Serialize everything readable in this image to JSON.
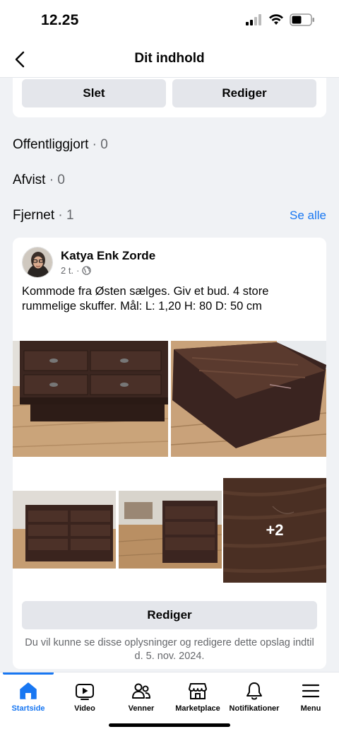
{
  "status_bar": {
    "time": "12.25"
  },
  "header": {
    "title": "Dit indhold"
  },
  "top_card": {
    "delete_label": "Slet",
    "edit_label": "Rediger"
  },
  "sections": {
    "published": {
      "label": "Offentliggjort",
      "count": "· 0"
    },
    "rejected": {
      "label": "Afvist",
      "count": "· 0"
    },
    "removed": {
      "label": "Fjernet",
      "count": "· 1",
      "see_all": "Se alle"
    }
  },
  "post": {
    "author": "Katya Enk Zorde",
    "time": "2 t.",
    "separator": "·",
    "text": "Kommode fra Østen sælges. Giv et bud. 4 store rummelige skuffer. Mål: L: 1,20 H: 80 D: 50 cm",
    "more_photos": "+2",
    "edit_label": "Rediger",
    "note": "Du vil kunne se disse oplysninger og redigere dette opslag indtil d. 5. nov. 2024."
  },
  "bottom_nav": {
    "tabs": [
      {
        "label": "Startside",
        "icon": "home-icon",
        "active": true
      },
      {
        "label": "Video",
        "icon": "video-icon",
        "active": false
      },
      {
        "label": "Venner",
        "icon": "friends-icon",
        "active": false
      },
      {
        "label": "Marketplace",
        "icon": "marketplace-icon",
        "active": false
      },
      {
        "label": "Notifikationer",
        "icon": "bell-icon",
        "active": false
      },
      {
        "label": "Menu",
        "icon": "menu-icon",
        "active": false
      }
    ]
  },
  "colors": {
    "accent": "#1877f2",
    "background": "#f0f2f5",
    "button_gray": "#e4e6eb",
    "secondary_text": "#65676b"
  }
}
